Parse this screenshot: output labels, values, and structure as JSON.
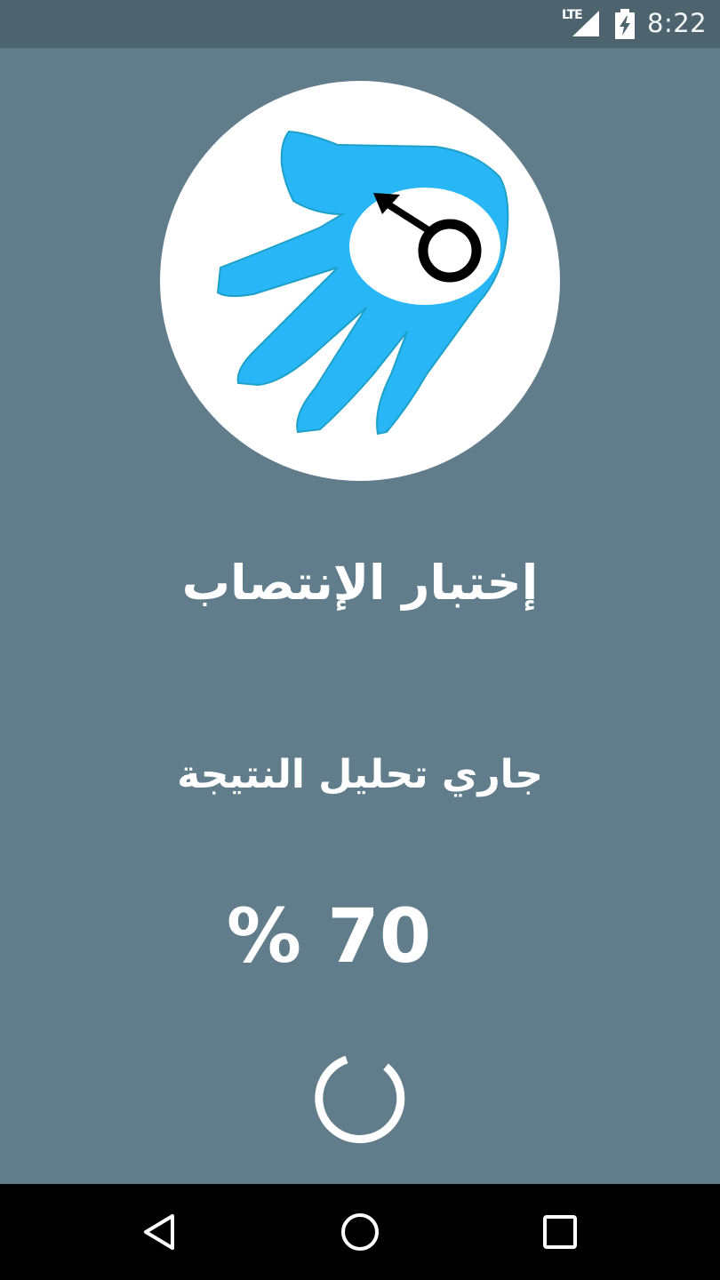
{
  "status_bar": {
    "network": "LTE",
    "time": "8:22",
    "signal_icon": "signal-icon",
    "battery_icon": "battery-charging-icon"
  },
  "main": {
    "logo_icon": "hand-male-symbol-logo",
    "title": "إختبار الإنتصاب",
    "status": "جاري تحليل النتيجة",
    "progress_text": "% 70",
    "progress_percent": 70,
    "spinner_icon": "loading-spinner-icon"
  },
  "nav_bar": {
    "back_icon": "back-icon",
    "home_icon": "home-icon",
    "recents_icon": "recents-icon"
  },
  "colors": {
    "background": "#617d8b",
    "status_bar": "#4d636e",
    "logo_blue": "#29b6f6",
    "text": "#ffffff"
  }
}
